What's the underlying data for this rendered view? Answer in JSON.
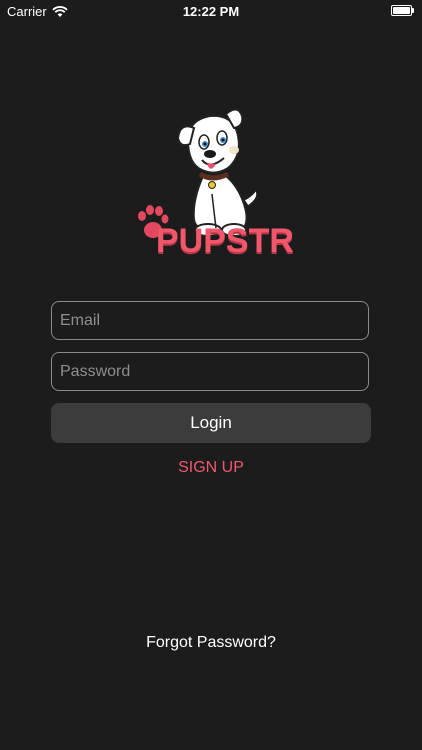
{
  "status_bar": {
    "carrier": "Carrier",
    "time": "12:22 PM"
  },
  "logo": {
    "text": "PUPSTR",
    "icon": "puppy-logo"
  },
  "login_form": {
    "email_placeholder": "Email",
    "email_value": "",
    "password_placeholder": "Password",
    "password_value": "",
    "login_label": "Login"
  },
  "links": {
    "signup": "SIGN UP",
    "forgot_password": "Forgot Password?"
  },
  "colors": {
    "background": "#1c1c1c",
    "accent": "#f0576a",
    "button": "#3c3c3c"
  }
}
